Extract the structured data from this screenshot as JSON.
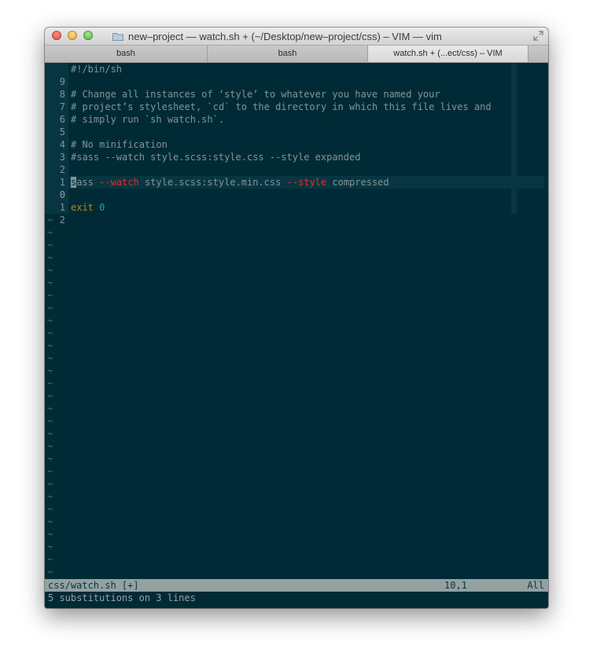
{
  "window": {
    "title": "new–project — watch.sh + (~/Desktop/new–project/css) – VIM — vim"
  },
  "tabs": [
    {
      "label": "bash",
      "active": false
    },
    {
      "label": "bash",
      "active": false
    },
    {
      "label": "watch.sh + (...ect/css) – VIM",
      "active": true
    }
  ],
  "editor": {
    "lines": [
      {
        "num": "9",
        "text": "#!/bin/sh"
      },
      {
        "num": "8",
        "text": ""
      },
      {
        "num": "7",
        "text": "# Change all instances of ‘style’ to whatever you have named your"
      },
      {
        "num": "6",
        "text": "# project’s stylesheet, `cd` to the directory in which this file lives and"
      },
      {
        "num": "5",
        "text": "# simply run `sh watch.sh`."
      },
      {
        "num": "4",
        "text": ""
      },
      {
        "num": "3",
        "text": "# No minification"
      },
      {
        "num": "2",
        "text": "#sass --watch style.scss:style.css --style expanded"
      },
      {
        "num": "1",
        "text": ""
      },
      {
        "num": "0",
        "text": "sass --watch style.scss:style.min.css --style compressed",
        "current": true
      },
      {
        "num": "1",
        "text": ""
      },
      {
        "num": "2",
        "text": "exit 0"
      }
    ],
    "current_line": {
      "cursor_char": "s",
      "part1": "ass ",
      "flag1": "--watch",
      "part2": " style.scss:style.min.css ",
      "flag2": "--style",
      "part3": " compressed"
    },
    "exit_line": {
      "keyword": "exit",
      "value": "0"
    },
    "tilde": "~",
    "tilde_count": 29
  },
  "statusline": {
    "file": "css/watch.sh [+]",
    "position": "10,1",
    "scroll": "All"
  },
  "cmdline": {
    "message": "5 substitutions on 3 lines"
  },
  "colors": {
    "background": "#002b36",
    "cursorline": "#073642",
    "comment": "#839496",
    "flag": "#dc322f",
    "keyword": "#b58900",
    "number": "#2aa198"
  }
}
